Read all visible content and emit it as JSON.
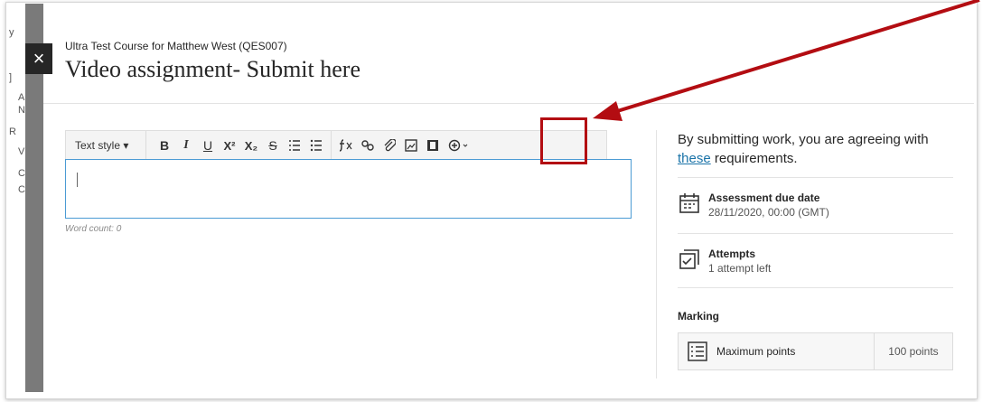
{
  "background_peek": [
    "y",
    "]",
    "A",
    "N",
    "R",
    "V",
    "C",
    "C"
  ],
  "close_glyph": "×",
  "course": "Ultra Test Course for Matthew West (QES007)",
  "title": "Video assignment- Submit here",
  "toolbar": {
    "text_style": "Text style",
    "buttons": [
      "B",
      "I",
      "U",
      "X²",
      "X₂",
      "S"
    ]
  },
  "editor": {
    "word_count": "Word count: 0"
  },
  "side": {
    "agree_prefix": "By submitting work, you are agreeing with",
    "agree_link": "these",
    "agree_suffix": "requirements.",
    "due_title": "Assessment due date",
    "due_value": "28/11/2020, 00:00 (GMT)",
    "attempts_title": "Attempts",
    "attempts_value": "1 attempt left",
    "marking_label": "Marking",
    "points_label": "Maximum points",
    "points_value": "100 points"
  },
  "colors": {
    "annotation": "#b30d12",
    "link": "#1a73a8",
    "editor_border": "#4b9bd4"
  }
}
